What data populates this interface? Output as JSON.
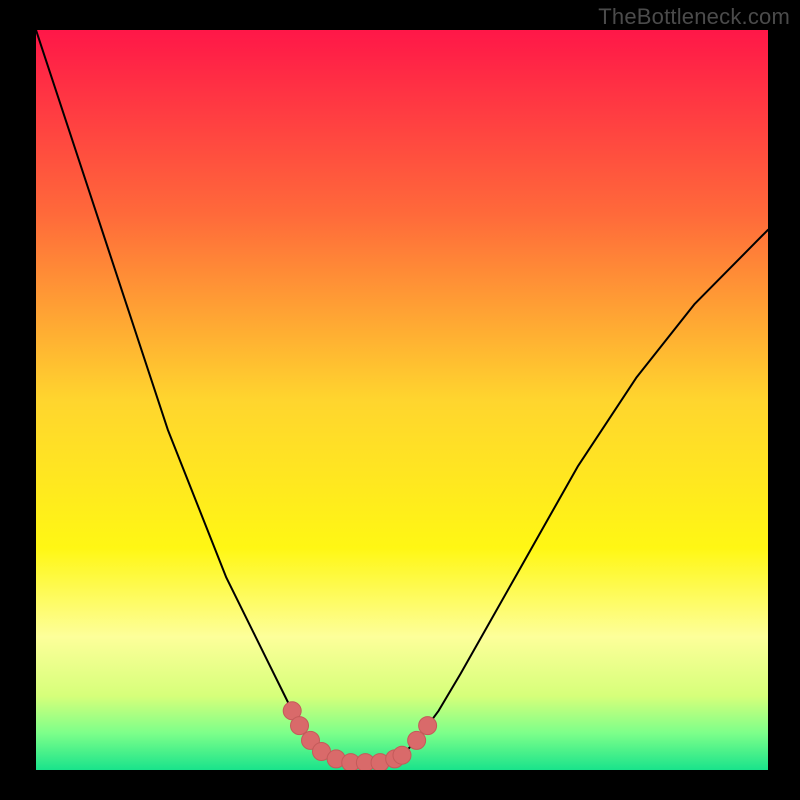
{
  "watermark": "TheBottleneck.com",
  "chart_data": {
    "type": "line",
    "title": "",
    "xlabel": "",
    "ylabel": "",
    "xlim": [
      0,
      100
    ],
    "ylim": [
      0,
      100
    ],
    "grid": false,
    "legend": false,
    "background": {
      "type": "vertical-gradient",
      "stops": [
        {
          "pos": 0.0,
          "color": "#ff1748"
        },
        {
          "pos": 0.25,
          "color": "#ff6a3a"
        },
        {
          "pos": 0.5,
          "color": "#ffd52e"
        },
        {
          "pos": 0.7,
          "color": "#fff714"
        },
        {
          "pos": 0.82,
          "color": "#fdff9a"
        },
        {
          "pos": 0.9,
          "color": "#d6ff7a"
        },
        {
          "pos": 0.95,
          "color": "#7dff8a"
        },
        {
          "pos": 1.0,
          "color": "#19e38b"
        }
      ]
    },
    "series": [
      {
        "name": "bottleneck-curve",
        "stroke": "#000000",
        "stroke_width": 2,
        "x": [
          0.0,
          2.0,
          4.0,
          6.0,
          8.0,
          10.0,
          12.0,
          14.0,
          16.0,
          18.0,
          20.0,
          22.0,
          24.0,
          26.0,
          28.0,
          30.0,
          32.0,
          34.0,
          35.0,
          36.0,
          37.5,
          39.0,
          41.0,
          43.0,
          45.0,
          47.0,
          49.0,
          50.0,
          52.0,
          55.0,
          58.0,
          62.0,
          66.0,
          70.0,
          74.0,
          78.0,
          82.0,
          86.0,
          90.0,
          94.0,
          98.0,
          100.0
        ],
        "y": [
          100.0,
          94.0,
          88.0,
          82.0,
          76.0,
          70.0,
          64.0,
          58.0,
          52.0,
          46.0,
          41.0,
          36.0,
          31.0,
          26.0,
          22.0,
          18.0,
          14.0,
          10.0,
          8.0,
          6.0,
          4.0,
          2.5,
          1.5,
          1.0,
          1.0,
          1.0,
          1.5,
          2.0,
          4.0,
          8.0,
          13.0,
          20.0,
          27.0,
          34.0,
          41.0,
          47.0,
          53.0,
          58.0,
          63.0,
          67.0,
          71.0,
          73.0
        ]
      }
    ],
    "markers": {
      "name": "optimal-zone-markers",
      "color": "#d96a6a",
      "stroke": "#c45a5a",
      "radius": 9,
      "points": [
        {
          "x": 35.0,
          "y": 8.0
        },
        {
          "x": 36.0,
          "y": 6.0
        },
        {
          "x": 37.5,
          "y": 4.0
        },
        {
          "x": 39.0,
          "y": 2.5
        },
        {
          "x": 41.0,
          "y": 1.5
        },
        {
          "x": 43.0,
          "y": 1.0
        },
        {
          "x": 45.0,
          "y": 1.0
        },
        {
          "x": 47.0,
          "y": 1.0
        },
        {
          "x": 49.0,
          "y": 1.5
        },
        {
          "x": 50.0,
          "y": 2.0
        },
        {
          "x": 52.0,
          "y": 4.0
        },
        {
          "x": 53.5,
          "y": 6.0
        }
      ]
    }
  }
}
